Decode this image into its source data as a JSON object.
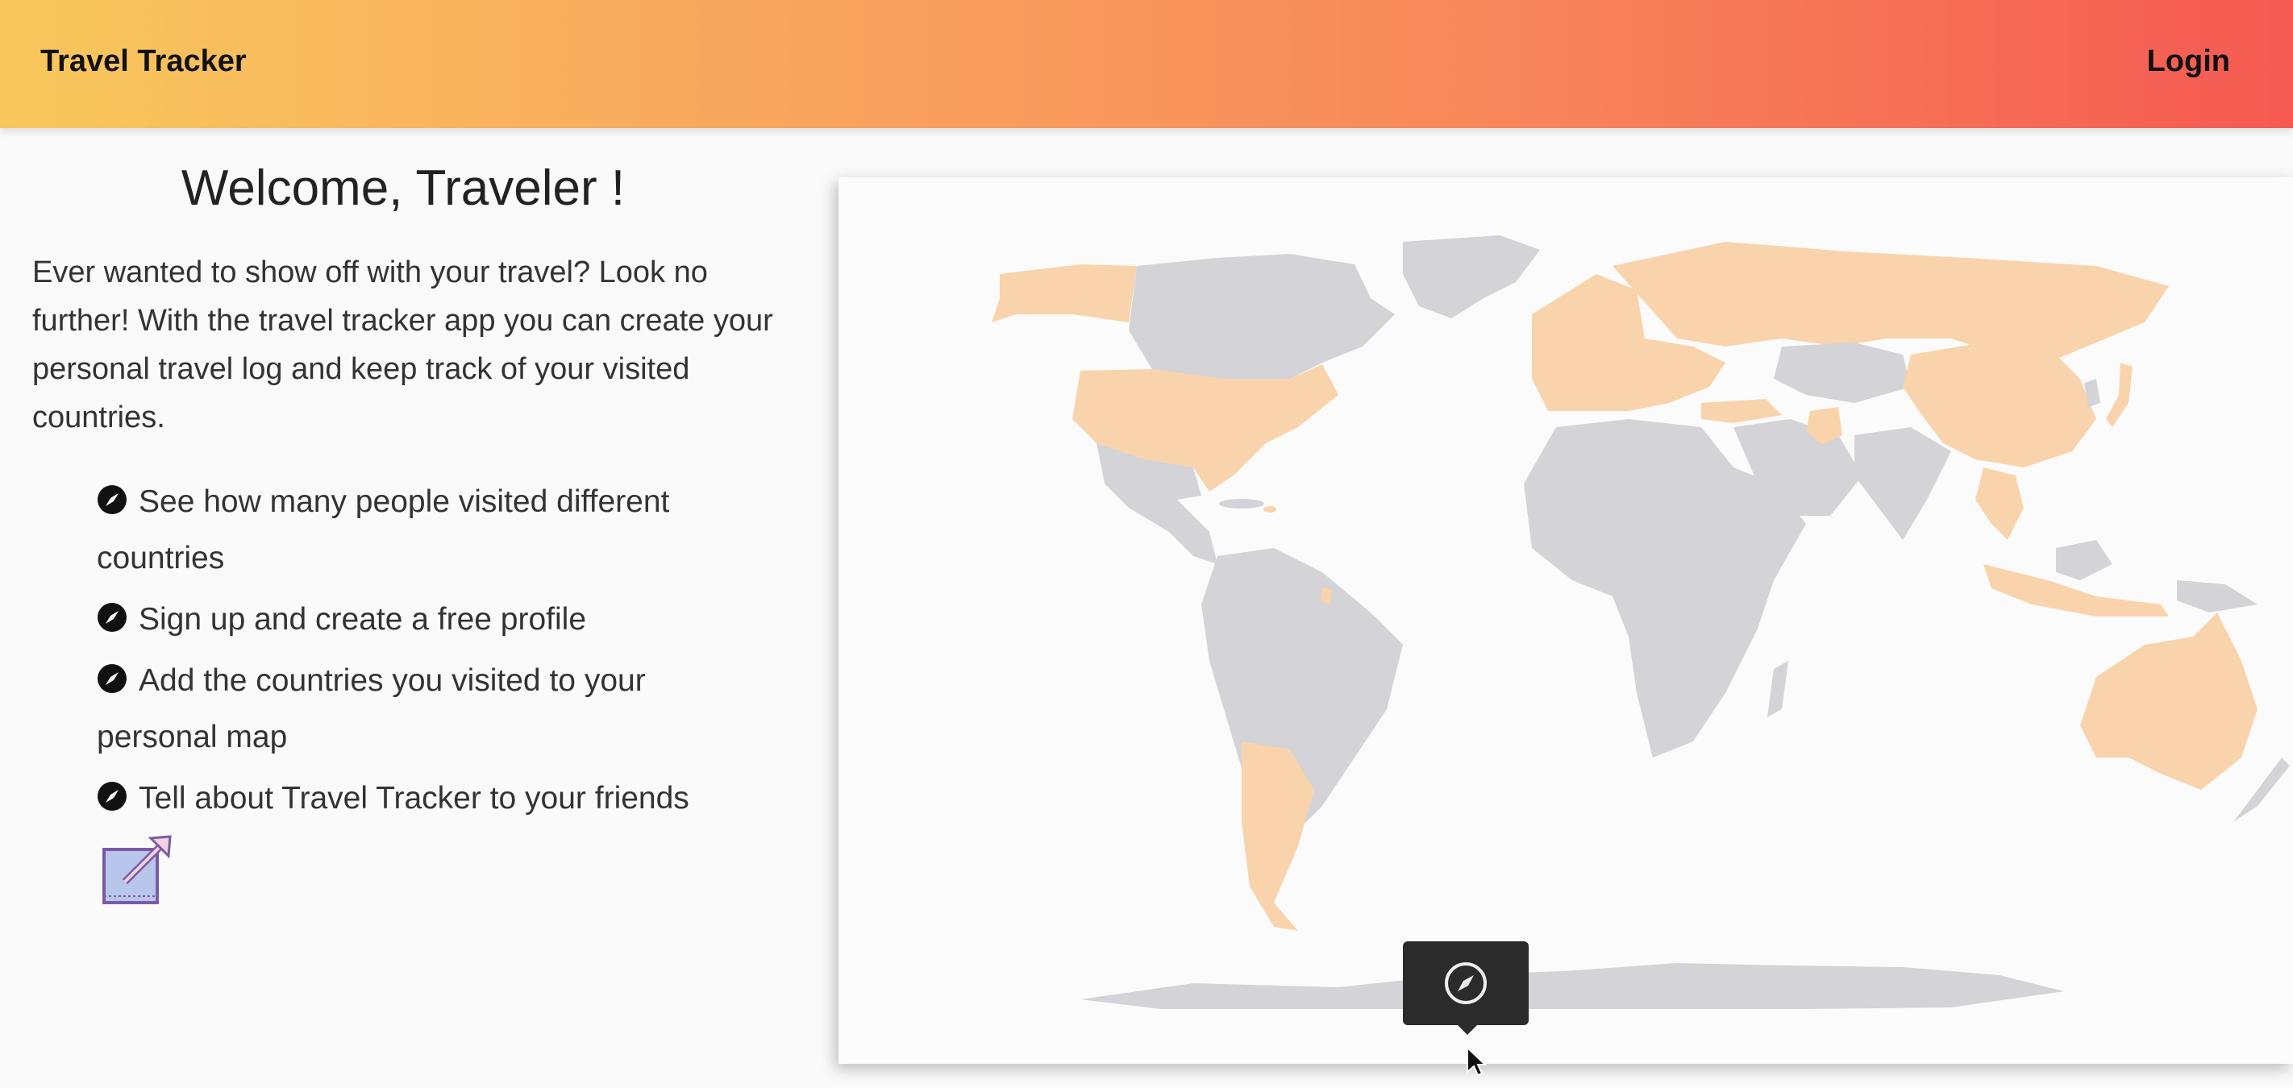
{
  "navbar": {
    "brand": "Travel Tracker",
    "login_label": "Login"
  },
  "welcome": {
    "title": "Welcome, Traveler !"
  },
  "intro": {
    "text": "Ever wanted to show off with your travel? Look no further! With the travel tracker app you can create your personal travel log and keep track of your visited countries."
  },
  "features": [
    {
      "text": "See how many people visited different countries"
    },
    {
      "text": "Sign up and create a free profile"
    },
    {
      "text": "Add the countries you visited to your personal map"
    },
    {
      "text": "Tell about Travel Tracker to your friends"
    }
  ],
  "icons": {
    "feature_bullet": "compass-icon",
    "decoration": "map-expand-icon",
    "tooltip": "compass-icon"
  },
  "colors": {
    "visited": "#f9d3ab",
    "unvisited": "#d3d3d8",
    "nav_start": "#f8c85c",
    "nav_end": "#f55a52"
  }
}
